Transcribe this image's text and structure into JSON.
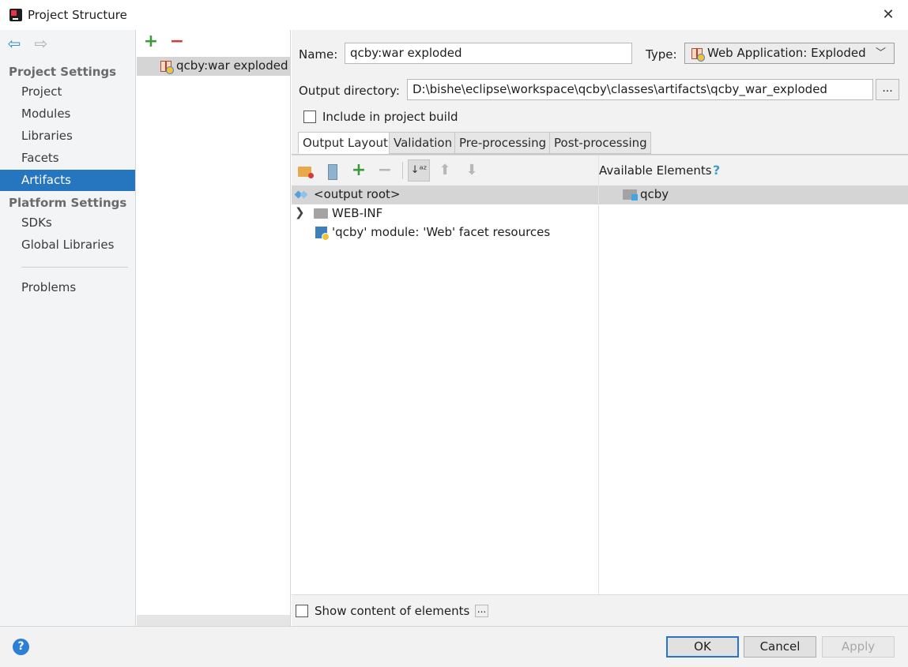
{
  "window": {
    "title": "Project Structure"
  },
  "nav": {
    "project_settings_header": "Project Settings",
    "project_items": [
      "Project",
      "Modules",
      "Libraries",
      "Facets",
      "Artifacts"
    ],
    "platform_settings_header": "Platform Settings",
    "platform_items": [
      "SDKs",
      "Global Libraries"
    ],
    "problems": "Problems",
    "selected": "Artifacts"
  },
  "artifacts": {
    "add_symbol": "+",
    "remove_symbol": "−",
    "items": [
      "qcby:war exploded"
    ]
  },
  "form": {
    "name_label": "Name:",
    "name_value": "qcby:war exploded",
    "type_label": "Type:",
    "type_value": "Web Application: Exploded",
    "output_dir_label": "Output directory:",
    "output_dir_value": "D:\\bishe\\eclipse\\workspace\\qcby\\classes\\artifacts\\qcby_war_exploded",
    "browse_label": "...",
    "include_build_label": "Include in project build",
    "include_build_checked": false
  },
  "tabs": [
    "Output Layout",
    "Validation",
    "Pre-processing",
    "Post-processing"
  ],
  "active_tab": "Output Layout",
  "layout": {
    "tree": [
      {
        "label": "<output root>",
        "icon": "output-root-icon",
        "selected": true
      },
      {
        "label": "WEB-INF",
        "icon": "folder-icon",
        "expandable": true
      },
      {
        "label": "'qcby' module: 'Web' facet resources",
        "icon": "module-icon"
      }
    ],
    "available_label": "Available Elements",
    "available_help": "?",
    "available_items": [
      "qcby"
    ],
    "show_content_label": "Show content of elements",
    "show_content_checked": false,
    "show_content_more": "..."
  },
  "footer": {
    "help": "?",
    "ok": "OK",
    "cancel": "Cancel",
    "apply": "Apply"
  },
  "colors": {
    "selection_blue": "#2675bf",
    "add_green": "#3b9a3b",
    "remove_red": "#d9383a",
    "default_button_border": "#2b74c4"
  }
}
